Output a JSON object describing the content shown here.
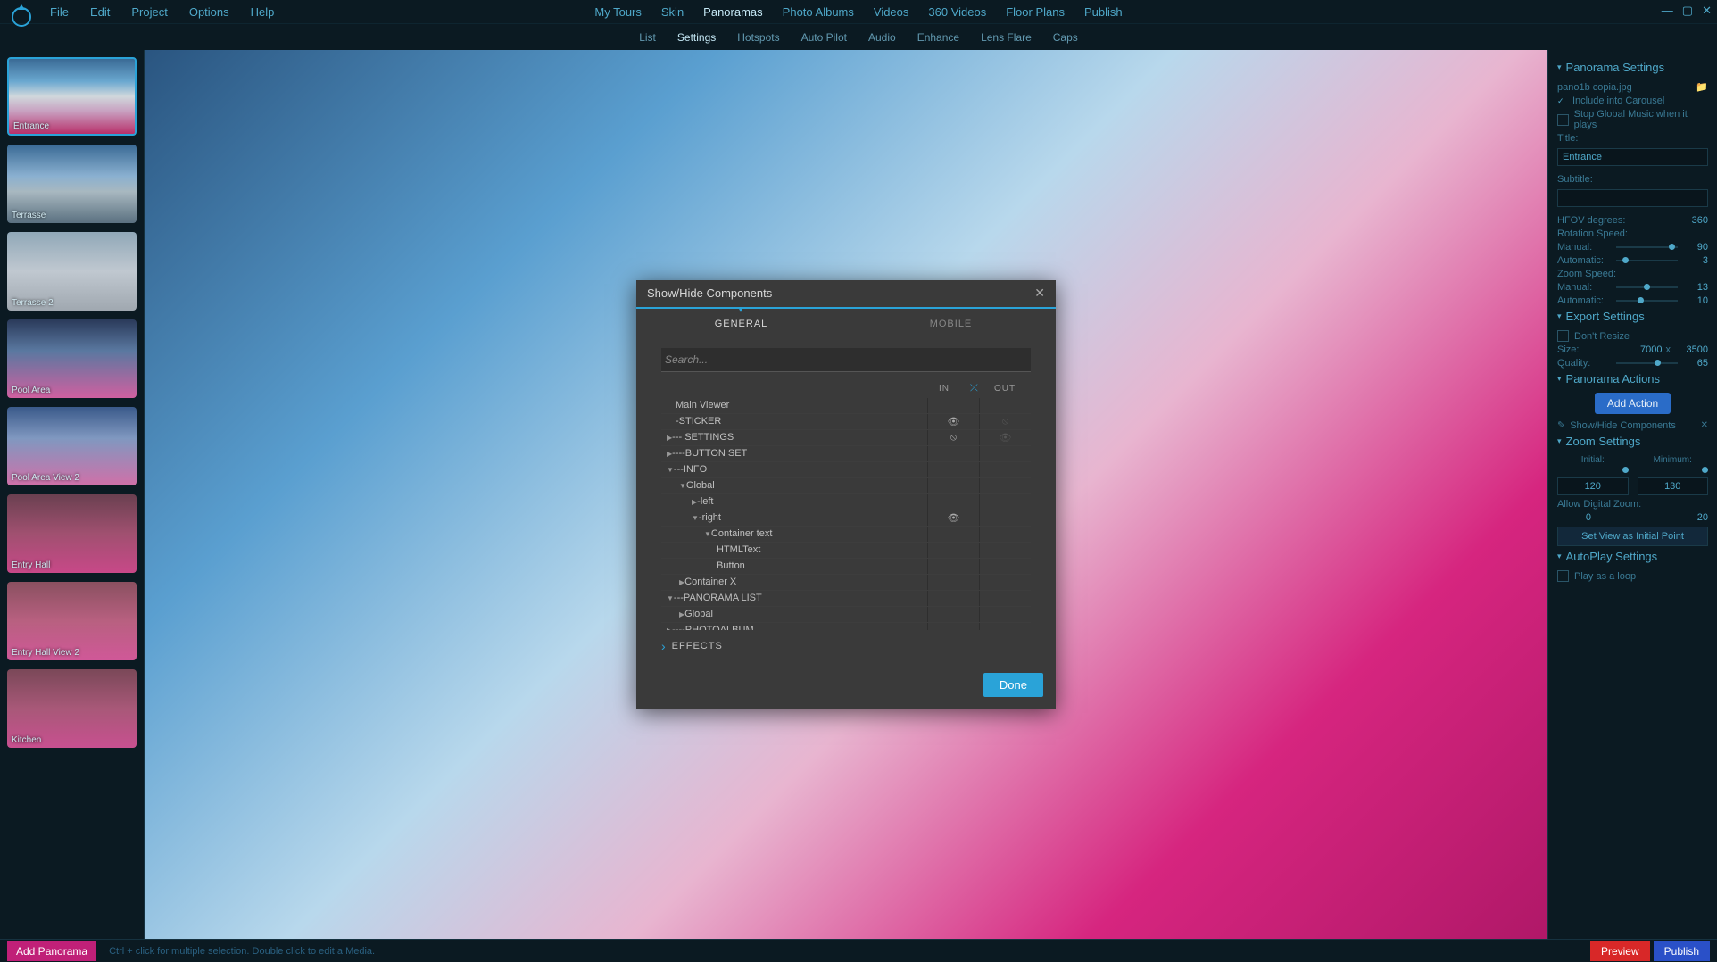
{
  "menubar": {
    "left": [
      "File",
      "Edit",
      "Project",
      "Options",
      "Help"
    ],
    "center": [
      "My Tours",
      "Skin",
      "Panoramas",
      "Photo Albums",
      "Videos",
      "360 Videos",
      "Floor Plans",
      "Publish"
    ],
    "center_active": "Panoramas"
  },
  "subnav": {
    "items": [
      "List",
      "Settings",
      "Hotspots",
      "Auto Pilot",
      "Audio",
      "Enhance",
      "Lens Flare",
      "Caps"
    ],
    "active": "Settings"
  },
  "thumbnails": [
    {
      "label": "Entrance",
      "selected": true
    },
    {
      "label": "Terrasse"
    },
    {
      "label": "Terrasse 2"
    },
    {
      "label": "Pool Area"
    },
    {
      "label": "Pool Area View 2"
    },
    {
      "label": "Entry Hall"
    },
    {
      "label": "Entry Hall View 2"
    },
    {
      "label": "Kitchen"
    }
  ],
  "right": {
    "panorama_settings_title": "Panorama Settings",
    "filename": "pano1b copia.jpg",
    "include_carousel": "Include into Carousel",
    "stop_music": "Stop Global Music when it plays",
    "title_label": "Title:",
    "title_value": "Entrance",
    "subtitle_label": "Subtitle:",
    "hfov_label": "HFOV degrees:",
    "hfov_value": "360",
    "rotation_speed_label": "Rotation Speed:",
    "manual_label": "Manual:",
    "rot_manual": "90",
    "automatic_label": "Automatic:",
    "rot_auto": "3",
    "zoom_speed_label": "Zoom Speed:",
    "zoom_manual": "13",
    "zoom_auto": "10",
    "export_title": "Export Settings",
    "dont_resize": "Don't Resize",
    "size_label": "Size:",
    "size_w": "7000",
    "size_x": "x",
    "size_h": "3500",
    "quality_label": "Quality:",
    "quality_val": "65",
    "actions_title": "Panorama Actions",
    "add_action": "Add Action",
    "show_hide_comp": "Show/Hide Components",
    "zoom_settings_title": "Zoom Settings",
    "initial_label": "Initial:",
    "minimum_label": "Minimum:",
    "initial_val": "120",
    "minimum_val": "130",
    "allow_digital": "Allow Digital Zoom:",
    "dz_val0": "0",
    "dz_val1": "20",
    "set_initial_btn": "Set View as Initial Point",
    "autoplay_title": "AutoPlay Settings",
    "play_loop": "Play as a loop"
  },
  "bottom": {
    "add_panorama": "Add Panorama",
    "hint": "Ctrl + click for multiple selection. Double click to edit a Media.",
    "preview": "Preview",
    "publish": "Publish"
  },
  "modal": {
    "title": "Show/Hide Components",
    "tab_general": "GENERAL",
    "tab_mobile": "MOBILE",
    "search_placeholder": "Search...",
    "col_in": "IN",
    "col_out": "OUT",
    "tree": [
      {
        "label": "Main Viewer",
        "indent": 0,
        "arrow": "",
        "in": "",
        "out": ""
      },
      {
        "label": "-STICKER",
        "indent": 0,
        "arrow": "",
        "in": "eye",
        "out": "eye-off-dim"
      },
      {
        "label": "--- SETTINGS",
        "indent": 1,
        "arrow": "▶",
        "in": "eye-off",
        "out": "eye-dim"
      },
      {
        "label": "----BUTTON SET",
        "indent": 1,
        "arrow": "▶",
        "in": "",
        "out": ""
      },
      {
        "label": "---INFO",
        "indent": 1,
        "arrow": "▼",
        "in": "",
        "out": ""
      },
      {
        "label": "Global",
        "indent": 2,
        "arrow": "▼",
        "in": "",
        "out": ""
      },
      {
        "label": "-left",
        "indent": 3,
        "arrow": "▶",
        "in": "",
        "out": ""
      },
      {
        "label": "-right",
        "indent": 3,
        "arrow": "▼",
        "in": "eye",
        "out": ""
      },
      {
        "label": "Container text",
        "indent": 4,
        "arrow": "▼",
        "in": "",
        "out": ""
      },
      {
        "label": "HTMLText",
        "indent": 5,
        "arrow": "",
        "in": "",
        "out": ""
      },
      {
        "label": "Button",
        "indent": 5,
        "arrow": "",
        "in": "",
        "out": ""
      },
      {
        "label": "Container X",
        "indent": 2,
        "arrow": "▶",
        "in": "",
        "out": ""
      },
      {
        "label": "---PANORAMA LIST",
        "indent": 1,
        "arrow": "▼",
        "in": "",
        "out": ""
      },
      {
        "label": "Global",
        "indent": 2,
        "arrow": "▶",
        "in": "",
        "out": ""
      },
      {
        "label": "----PHOTOALBUM",
        "indent": 1,
        "arrow": "▶",
        "in": "",
        "out": ""
      }
    ],
    "effects": "EFFECTS",
    "done": "Done"
  }
}
